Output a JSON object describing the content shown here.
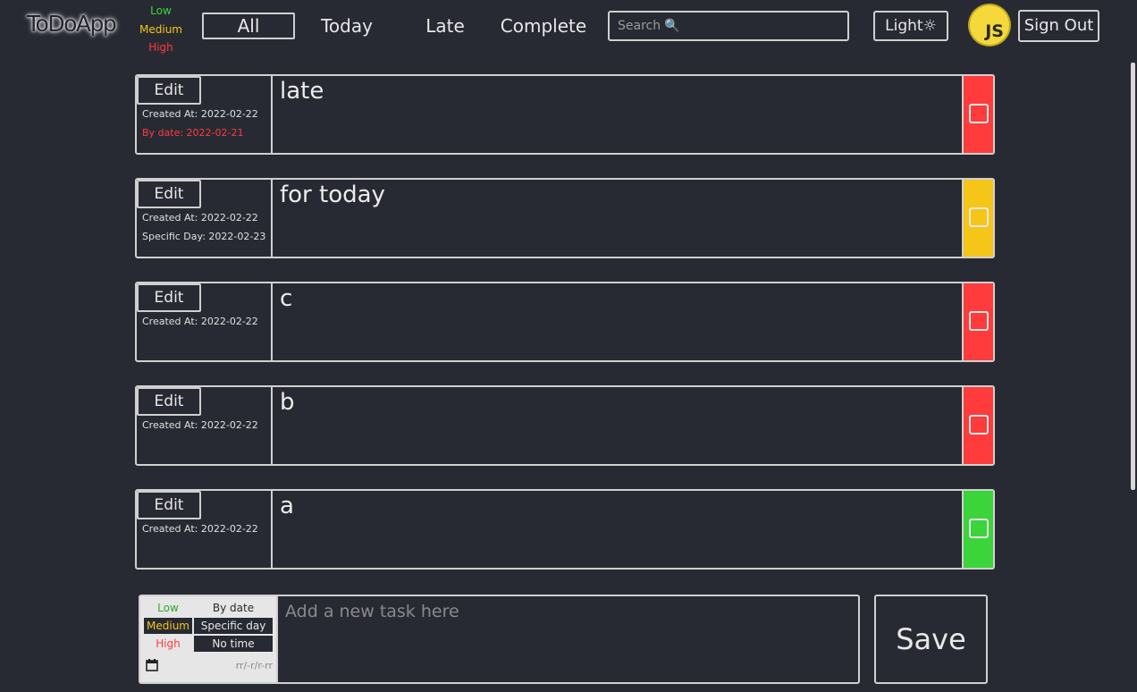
{
  "app": {
    "logo": "ToDoApp"
  },
  "legend": {
    "low": "Low",
    "medium": "Medium",
    "high": "High"
  },
  "nav": {
    "all": "All",
    "today": "Today",
    "late": "Late",
    "complete": "Complete"
  },
  "search": {
    "placeholder": "Search",
    "icon": "magnifier-icon"
  },
  "header": {
    "theme_label": "Light",
    "theme_icon": "☼",
    "avatar_initials": "JS",
    "signout": "Sign Out"
  },
  "colors": {
    "low": "#3bd43b",
    "medium": "#f5c518",
    "high": "#ff3b3b",
    "background": "#282a33"
  },
  "tasks": [
    {
      "edit": "Edit",
      "created": "Created At: 2022-02-22",
      "due": "By date: 2022-02-21",
      "text": "late",
      "priority": "high"
    },
    {
      "edit": "Edit",
      "created": "Created At: 2022-02-22",
      "due": "Specific Day: 2022-02-23",
      "text": "for today",
      "priority": "medium"
    },
    {
      "edit": "Edit",
      "created": "Created At: 2022-02-22",
      "text": "c",
      "priority": "high"
    },
    {
      "edit": "Edit",
      "created": "Created At: 2022-02-22",
      "text": "b",
      "priority": "high"
    },
    {
      "edit": "Edit",
      "created": "Created At: 2022-02-22",
      "text": "a",
      "priority": "low"
    }
  ],
  "form": {
    "priority_low": "Low",
    "priority_medium": "Medium",
    "priority_high": "High",
    "by_date": "By date",
    "specific_day": "Specific day",
    "no_time": "No time",
    "date_placeholder": "rr/-r/r-rr",
    "placeholder": "Add a new task here",
    "save": "Save"
  }
}
